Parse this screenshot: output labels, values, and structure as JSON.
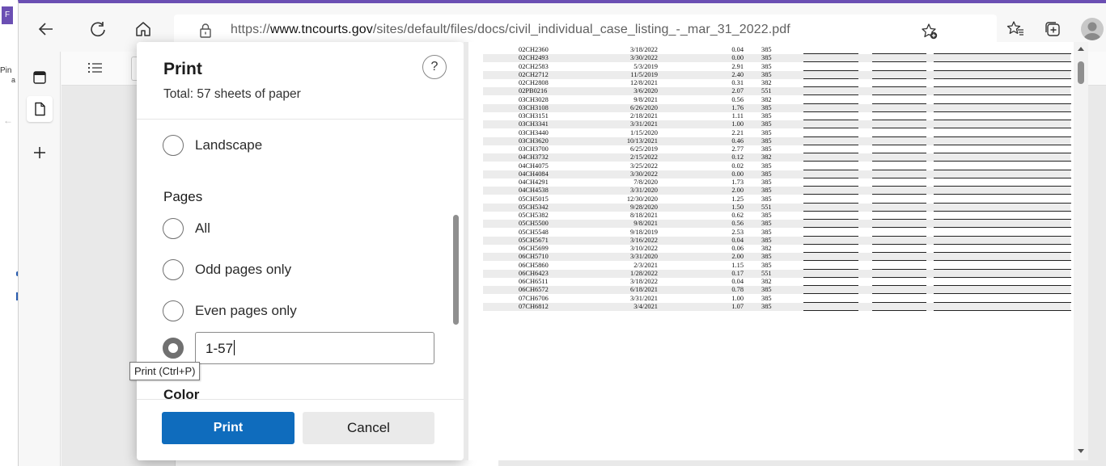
{
  "window": {
    "edge_button_label": "F",
    "edge_pin_label": "Pin",
    "edge_pin_sub": "a"
  },
  "toolbar": {
    "url_host_prefix": "https://",
    "url_host": "www.tncourts.gov",
    "url_path": "/sites/default/files/docs/civil_individual_case_listing_-_mar_31_2022.pdf",
    "icons": [
      "back-arrow-icon",
      "refresh-icon",
      "home-icon",
      "lock-icon",
      "add-favorite-icon",
      "favorites-icon",
      "collections-icon",
      "profile-avatar-icon"
    ]
  },
  "vertical_tabs": {
    "icons": [
      "tab-actions-icon",
      "pdf-tab-icon",
      "new-tab-plus-icon"
    ]
  },
  "viewer_toolbar": {
    "icons": [
      "contents-list-icon"
    ]
  },
  "print_dialog": {
    "title": "Print",
    "subtitle": "Total: 57 sheets of paper",
    "help_label": "?",
    "layout_option": "Landscape",
    "pages_label": "Pages",
    "pages_options": [
      "All",
      "Odd pages only",
      "Even pages only"
    ],
    "pages_custom_value": "1-57",
    "color_label_partial": "Color",
    "print_button": "Print",
    "cancel_button": "Cancel"
  },
  "tooltip": {
    "text": "Print (Ctrl+P)"
  },
  "preview": {
    "rows": [
      {
        "case": "02CH2360",
        "date": "3/18/2022",
        "amount": "0.04",
        "code": "385"
      },
      {
        "case": "02CH2493",
        "date": "3/30/2022",
        "amount": "0.00",
        "code": "385"
      },
      {
        "case": "02CH2583",
        "date": "5/3/2019",
        "amount": "2.91",
        "code": "385"
      },
      {
        "case": "02CH2712",
        "date": "11/5/2019",
        "amount": "2.40",
        "code": "385"
      },
      {
        "case": "02CH2808",
        "date": "12/8/2021",
        "amount": "0.31",
        "code": "382"
      },
      {
        "case": "02PB0216",
        "date": "3/6/2020",
        "amount": "2.07",
        "code": "551"
      },
      {
        "case": "03CH3028",
        "date": "9/8/2021",
        "amount": "0.56",
        "code": "382"
      },
      {
        "case": "03CH3108",
        "date": "6/26/2020",
        "amount": "1.76",
        "code": "385"
      },
      {
        "case": "03CH3151",
        "date": "2/18/2021",
        "amount": "1.11",
        "code": "385"
      },
      {
        "case": "03CH3341",
        "date": "3/31/2021",
        "amount": "1.00",
        "code": "385"
      },
      {
        "case": "03CH3440",
        "date": "1/15/2020",
        "amount": "2.21",
        "code": "385"
      },
      {
        "case": "03CH3620",
        "date": "10/13/2021",
        "amount": "0.46",
        "code": "385"
      },
      {
        "case": "03CH3700",
        "date": "6/25/2019",
        "amount": "2.77",
        "code": "385"
      },
      {
        "case": "04CH3732",
        "date": "2/15/2022",
        "amount": "0.12",
        "code": "382"
      },
      {
        "case": "04CH4075",
        "date": "3/25/2022",
        "amount": "0.02",
        "code": "385"
      },
      {
        "case": "04CH4084",
        "date": "3/30/2022",
        "amount": "0.00",
        "code": "385"
      },
      {
        "case": "04CH4291",
        "date": "7/8/2020",
        "amount": "1.73",
        "code": "385"
      },
      {
        "case": "04CH4538",
        "date": "3/31/2020",
        "amount": "2.00",
        "code": "385"
      },
      {
        "case": "05CH5015",
        "date": "12/30/2020",
        "amount": "1.25",
        "code": "385"
      },
      {
        "case": "05CH5342",
        "date": "9/28/2020",
        "amount": "1.50",
        "code": "551"
      },
      {
        "case": "05CH5382",
        "date": "8/18/2021",
        "amount": "0.62",
        "code": "385"
      },
      {
        "case": "05CH5500",
        "date": "9/8/2021",
        "amount": "0.56",
        "code": "385"
      },
      {
        "case": "05CH5548",
        "date": "9/18/2019",
        "amount": "2.53",
        "code": "385"
      },
      {
        "case": "05CH5671",
        "date": "3/16/2022",
        "amount": "0.04",
        "code": "385"
      },
      {
        "case": "06CH5699",
        "date": "3/10/2022",
        "amount": "0.06",
        "code": "382"
      },
      {
        "case": "06CH5710",
        "date": "3/31/2020",
        "amount": "2.00",
        "code": "385"
      },
      {
        "case": "06CH5860",
        "date": "2/3/2021",
        "amount": "1.15",
        "code": "385"
      },
      {
        "case": "06CH6423",
        "date": "1/28/2022",
        "amount": "0.17",
        "code": "551"
      },
      {
        "case": "06CH6511",
        "date": "3/18/2022",
        "amount": "0.04",
        "code": "382"
      },
      {
        "case": "06CH6572",
        "date": "6/18/2021",
        "amount": "0.78",
        "code": "385"
      },
      {
        "case": "07CH6706",
        "date": "3/31/2021",
        "amount": "1.00",
        "code": "385"
      },
      {
        "case": "07CH6812",
        "date": "3/4/2021",
        "amount": "1.07",
        "code": "385"
      }
    ]
  }
}
